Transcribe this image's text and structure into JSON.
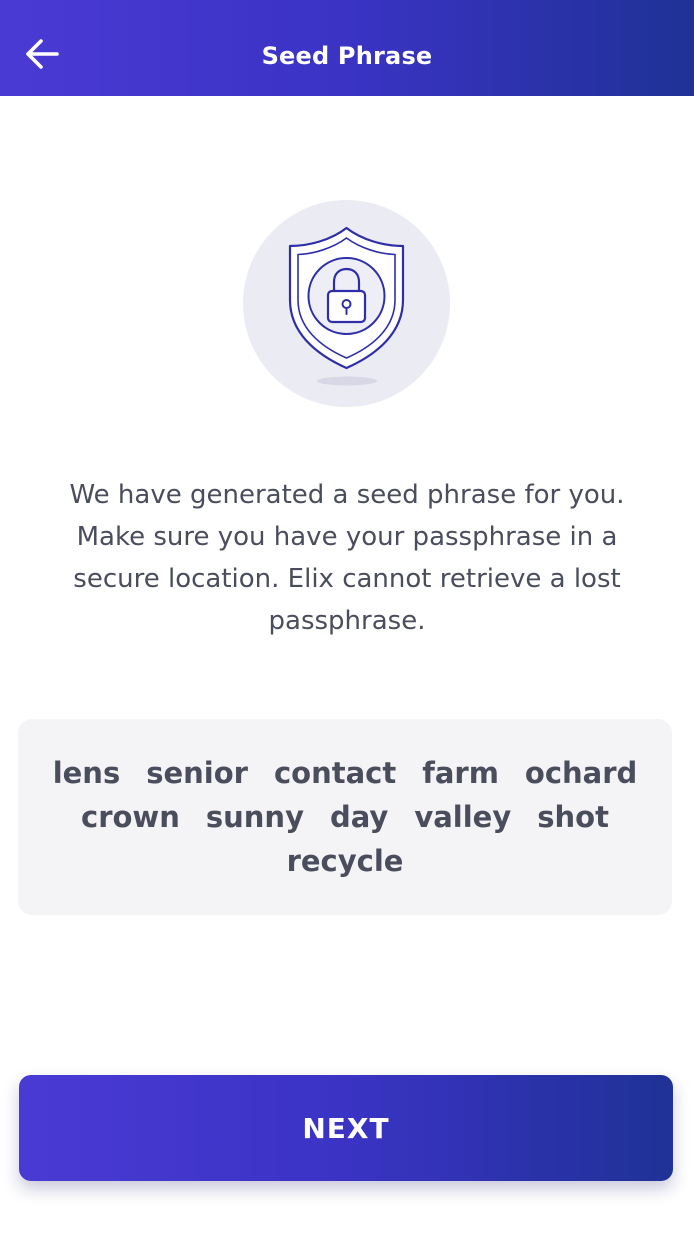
{
  "header": {
    "title": "Seed Phrase",
    "back_icon": "arrow-left-icon",
    "gradient_start": "#4a3ad4",
    "gradient_end": "#1f3296"
  },
  "illustration": {
    "icon": "shield-lock-icon",
    "circle_color": "#ebebf4",
    "stroke_color": "#2e2fa8"
  },
  "description": {
    "text": "We have generated a seed phrase for you.\nMake sure you have your passphrase in a\nsecure location. Elix cannot retrieve a lost\npassphrase."
  },
  "seed_phrase": {
    "words": [
      "lens",
      "senior",
      "contact",
      "farm",
      "ochard",
      "crown",
      "sunny",
      "day",
      "valley",
      "shot",
      "recycle"
    ]
  },
  "footer": {
    "next_label": "NEXT"
  }
}
